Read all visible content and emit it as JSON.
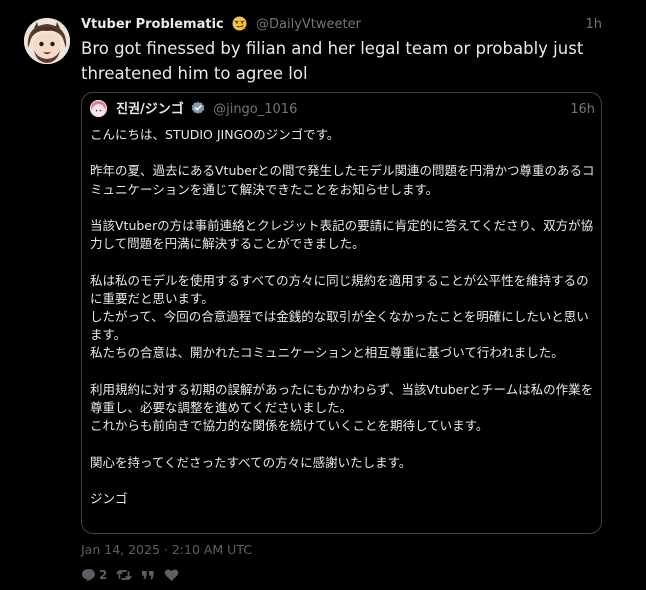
{
  "tweet": {
    "display_name": "Vtuber Problematic",
    "handle": "@DailyVtweeter",
    "time": "1h",
    "text": "Bro got finessed by filian and her legal team or probably just threatened him to agree lol",
    "timestamp": "Jan 14, 2025 · 2:10 AM UTC",
    "name_emoji": "smirking-face-emoji"
  },
  "quote": {
    "display_name": "진권/ジンゴ",
    "handle": "@jingo_1016",
    "time": "16h",
    "verified": true,
    "verified_color": "#829aab",
    "body": "こんにちは、STUDIO JINGOのジンゴです。\n\n昨年の夏、過去にあるVtuberとの間で発生したモデル関連の問題を円滑かつ尊重のあるコミュニケーションを通じて解決できたことをお知らせします。\n\n当該Vtuberの方は事前連絡とクレジット表記の要請に肯定的に答えてくださり、双方が協力して問題を円満に解決することができました。\n\n私は私のモデルを使用するすべての方々に同じ規約を適用することが公平性を維持するのに重要だと思います。\nしたがって、今回の合意過程では金銭的な取引が全くなかったことを明確にしたいと思います。\n私たちの合意は、開かれたコミュニケーションと相互尊重に基づいて行われました。\n\n利用規約に対する初期の誤解があったにもかかわらず、当該Vtuberとチームは私の作業を尊重し、必要な調整を進めてくださいました。\nこれからも前向きで協力的な関係を続けていくことを期待しています。\n\n関心を持ってくださったすべての方々に感謝いたします。\n\nジンゴ"
  },
  "actions": {
    "reply_count": "2",
    "icons": [
      "reply-icon",
      "retweet-icon",
      "quote-icon",
      "like-icon"
    ]
  },
  "colors": {
    "background": "#000000",
    "text": "#e7e9ea",
    "muted": "#71767b",
    "border": "#3e4144"
  }
}
